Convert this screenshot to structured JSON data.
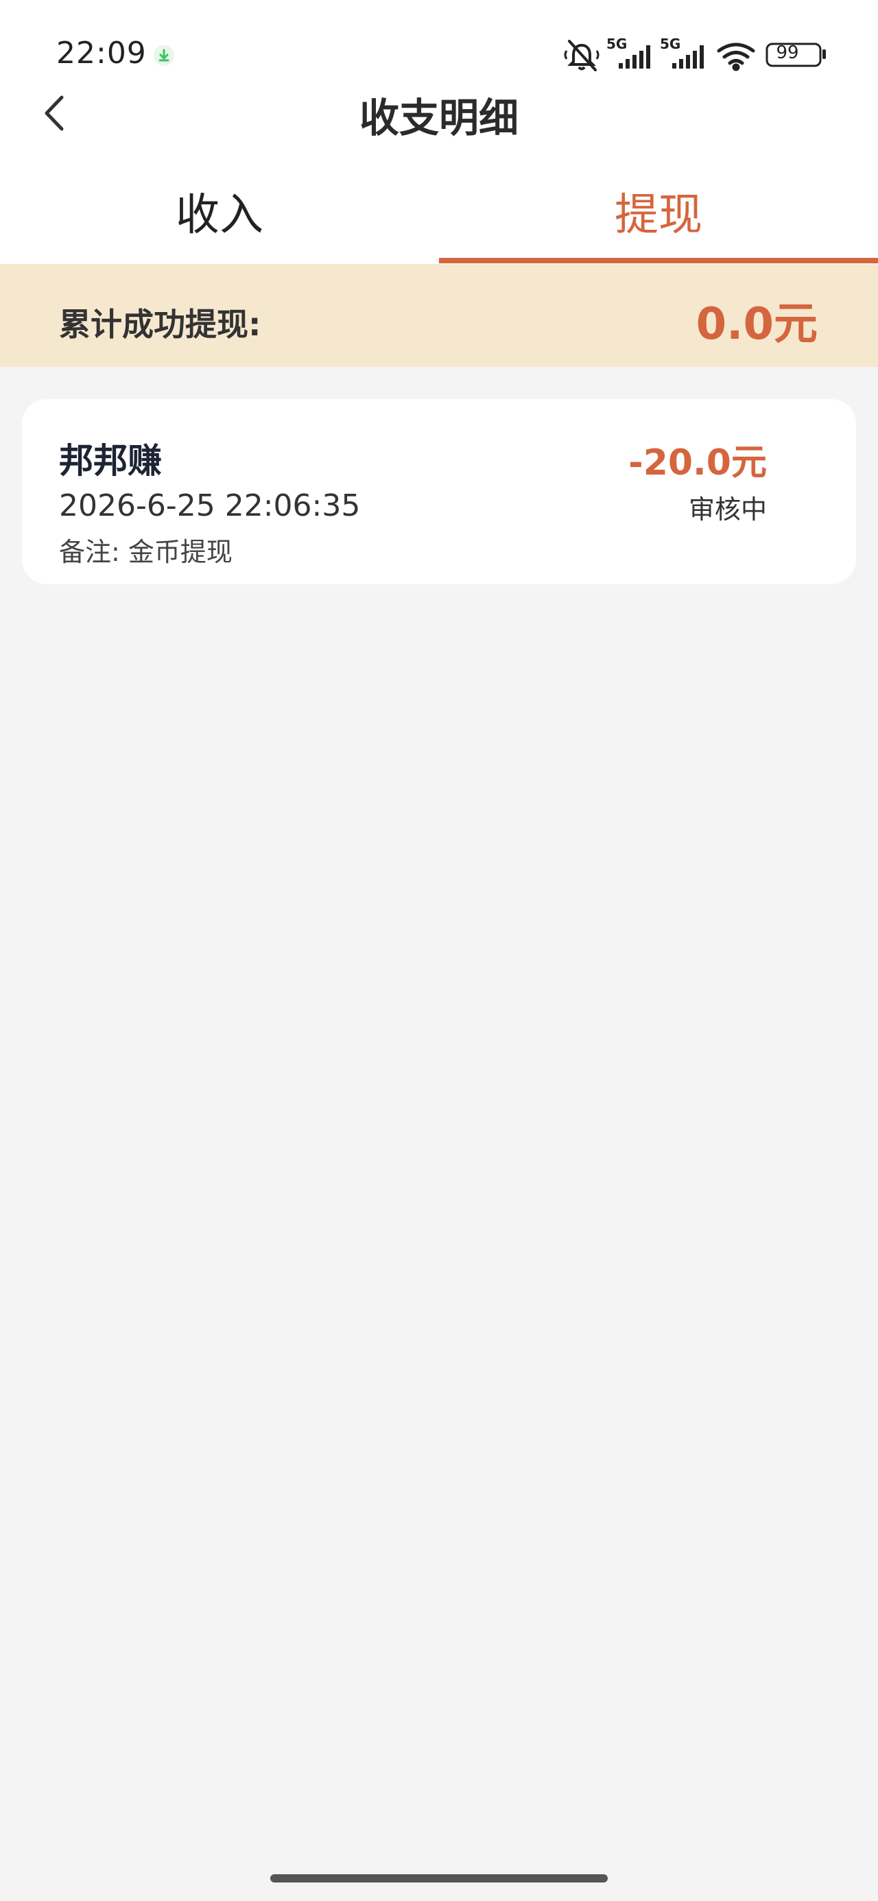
{
  "status_bar": {
    "time": "22:09",
    "signal1_label": "5G",
    "signal2_label": "5G",
    "battery": "99",
    "icons": [
      "download-icon",
      "mute-icon",
      "signal-icon",
      "wifi-icon",
      "battery-icon"
    ]
  },
  "nav": {
    "back_icon": "chevron-left-icon",
    "title": "收支明细"
  },
  "tabs": [
    {
      "label": "收入",
      "active": false
    },
    {
      "label": "提现",
      "active": true
    }
  ],
  "summary": {
    "label": "累计成功提现:",
    "value": "0.0元"
  },
  "records": [
    {
      "name": "邦邦赚",
      "time": "2026-6-25 22:06:35",
      "remark": "备注: 金币提现",
      "amount": "-20.0元",
      "status": "审核中"
    }
  ],
  "colors": {
    "accent": "#d5653d",
    "banner_bg": "#f6e8cf",
    "page_bg": "#f4f4f4"
  }
}
